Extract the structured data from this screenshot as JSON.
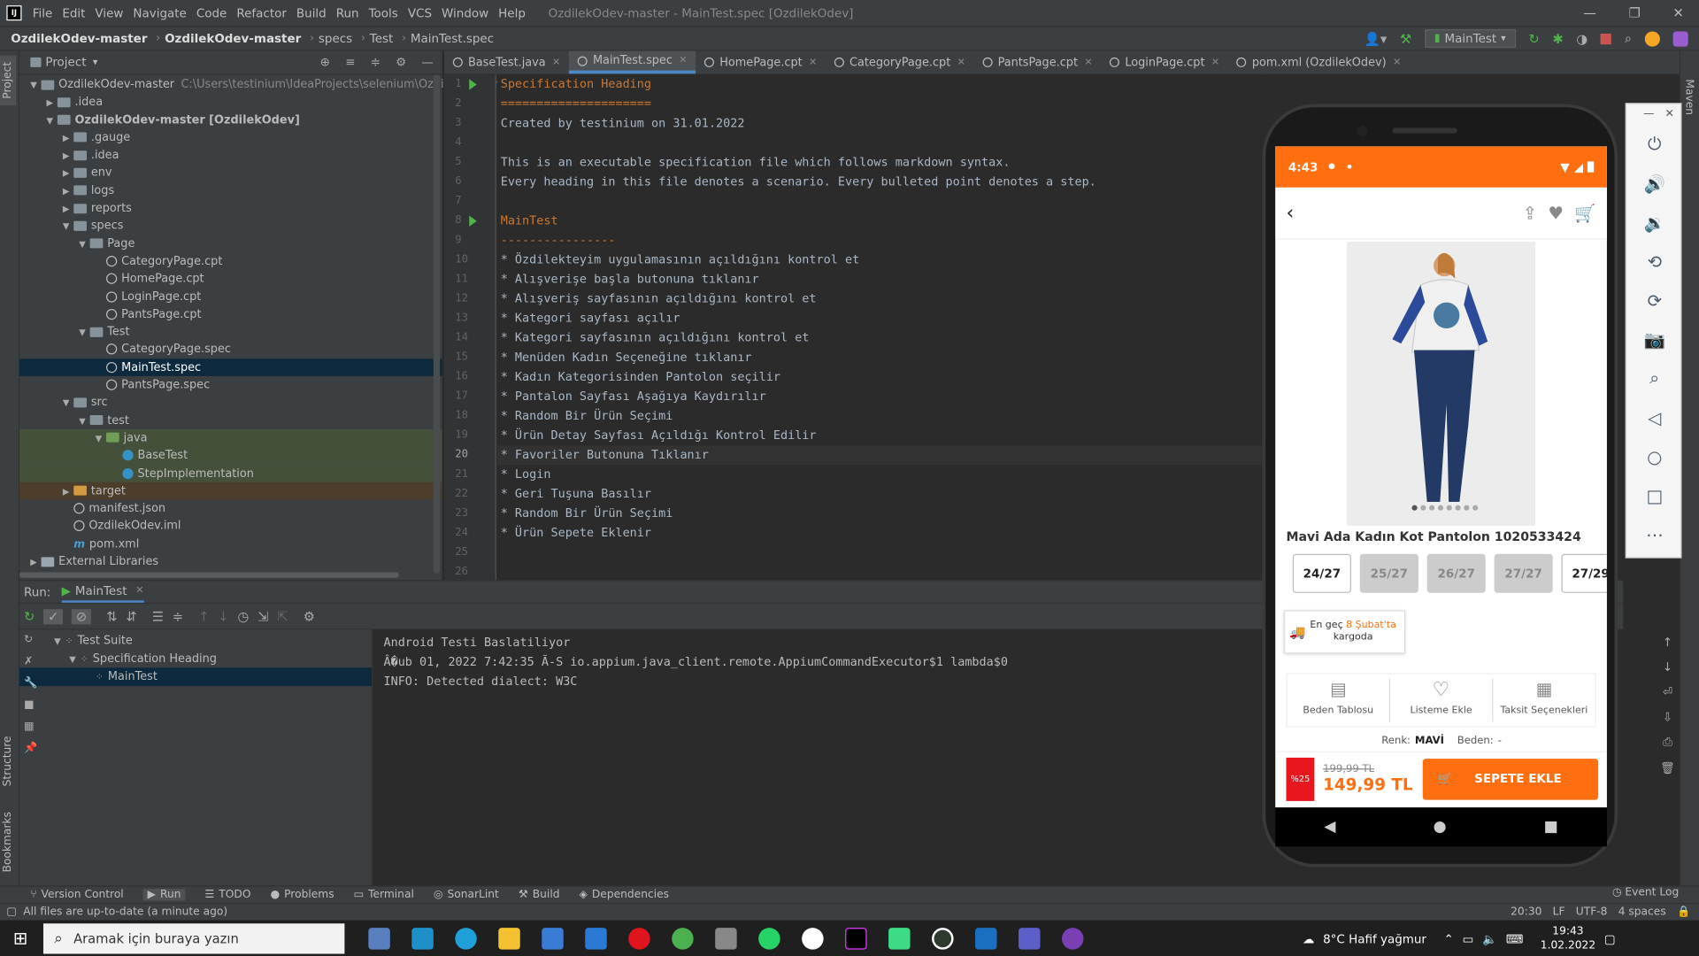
{
  "menu": [
    "File",
    "Edit",
    "View",
    "Navigate",
    "Code",
    "Refactor",
    "Build",
    "Run",
    "Tools",
    "VCS",
    "Window",
    "Help"
  ],
  "window_title": "OzdilekOdev-master - MainTest.spec [OzdilekOdev]",
  "breadcrumb": [
    "OzdilekOdev-master",
    "OzdilekOdev-master",
    "specs",
    "Test",
    "MainTest.spec"
  ],
  "run_config": "MainTest",
  "project": {
    "header": "Project",
    "tree": [
      {
        "label": "OzdilekOdev-master",
        "hint": "C:\\Users\\testinium\\IdeaProjects\\selenium\\OzdilekOdev-ma",
        "depth": 0,
        "arrow": "▼",
        "icon": "folder"
      },
      {
        "label": ".idea",
        "depth": 1,
        "arrow": "▶",
        "icon": "folder"
      },
      {
        "label": "OzdilekOdev-master [OzdilekOdev]",
        "depth": 1,
        "arrow": "▼",
        "icon": "folder",
        "bold": true
      },
      {
        "label": ".gauge",
        "depth": 2,
        "arrow": "▶",
        "icon": "folder"
      },
      {
        "label": ".idea",
        "depth": 2,
        "arrow": "▶",
        "icon": "folder"
      },
      {
        "label": "env",
        "depth": 2,
        "arrow": "▶",
        "icon": "folder"
      },
      {
        "label": "logs",
        "depth": 2,
        "arrow": "▶",
        "icon": "folder"
      },
      {
        "label": "reports",
        "depth": 2,
        "arrow": "▶",
        "icon": "folder"
      },
      {
        "label": "specs",
        "depth": 2,
        "arrow": "▼",
        "icon": "folder"
      },
      {
        "label": "Page",
        "depth": 3,
        "arrow": "▼",
        "icon": "folder"
      },
      {
        "label": "CategoryPage.cpt",
        "depth": 4,
        "arrow": "",
        "icon": "file"
      },
      {
        "label": "HomePage.cpt",
        "depth": 4,
        "arrow": "",
        "icon": "file"
      },
      {
        "label": "LoginPage.cpt",
        "depth": 4,
        "arrow": "",
        "icon": "file"
      },
      {
        "label": "PantsPage.cpt",
        "depth": 4,
        "arrow": "",
        "icon": "file"
      },
      {
        "label": "Test",
        "depth": 3,
        "arrow": "▼",
        "icon": "folder"
      },
      {
        "label": "CategoryPage.spec",
        "depth": 4,
        "arrow": "",
        "icon": "file"
      },
      {
        "label": "MainTest.spec",
        "depth": 4,
        "arrow": "",
        "icon": "file",
        "selected": true
      },
      {
        "label": "PantsPage.spec",
        "depth": 4,
        "arrow": "",
        "icon": "file"
      },
      {
        "label": "src",
        "depth": 2,
        "arrow": "▼",
        "icon": "folder"
      },
      {
        "label": "test",
        "depth": 3,
        "arrow": "▼",
        "icon": "folder"
      },
      {
        "label": "java",
        "depth": 4,
        "arrow": "▼",
        "icon": "green",
        "green": true
      },
      {
        "label": "BaseTest",
        "depth": 5,
        "arrow": "",
        "icon": "class",
        "green": true
      },
      {
        "label": "StepImplementation",
        "depth": 5,
        "arrow": "",
        "icon": "class",
        "green": true
      },
      {
        "label": "target",
        "depth": 2,
        "arrow": "▶",
        "icon": "orange",
        "brown": true
      },
      {
        "label": "manifest.json",
        "depth": 2,
        "arrow": "",
        "icon": "file"
      },
      {
        "label": "OzdilekOdev.iml",
        "depth": 2,
        "arrow": "",
        "icon": "file"
      },
      {
        "label": "pom.xml",
        "depth": 2,
        "arrow": "",
        "icon": "maven"
      },
      {
        "label": "External Libraries",
        "depth": 0,
        "arrow": "▶",
        "icon": "lib"
      }
    ]
  },
  "tabs": [
    {
      "label": "BaseTest.java"
    },
    {
      "label": "MainTest.spec",
      "active": true
    },
    {
      "label": "HomePage.cpt"
    },
    {
      "label": "CategoryPage.cpt"
    },
    {
      "label": "PantsPage.cpt"
    },
    {
      "label": "LoginPage.cpt"
    },
    {
      "label": "pom.xml (OzdilekOdev)"
    }
  ],
  "code_lines": [
    "Specification Heading",
    "=====================",
    "Created by testinium on 31.01.2022",
    "",
    "This is an executable specification file which follows markdown syntax.",
    "Every heading in this file denotes a scenario. Every bulleted point denotes a step.",
    "",
    "MainTest",
    "----------------",
    "* Özdilekteyim uygulamasının açıldığını kontrol et",
    "* Alışverişe başla butonuna tıklanır",
    "* Alışveriş sayfasının açıldığını kontrol et",
    "* Kategori sayfası açılır",
    "* Kategori sayfasının açıldığını kontrol et",
    "* Menüden Kadın Seçeneğine tıklanır",
    "* Kadın Kategorisinden Pantolon seçilir",
    "* Pantalon Sayfası Aşağıya Kaydırılır",
    "* Random Bir Ürün Seçimi",
    "* Ürün Detay Sayfası Açıldığı Kontrol Edilir",
    "* Favoriler Butonuna Tıklanır",
    "* Login",
    "* Geri Tuşuna Basılır",
    "* Random Bir Ürün Seçimi",
    "* Ürün Sepete Eklenir",
    "",
    ""
  ],
  "run": {
    "label": "Run:",
    "config": "MainTest",
    "tree": [
      {
        "label": "Test Suite",
        "depth": 0
      },
      {
        "label": "Specification Heading",
        "depth": 1
      },
      {
        "label": "MainTest",
        "depth": 2,
        "selected": true
      }
    ],
    "console": [
      "Android Testi Baslatiliyor",
      "Â�ub 01, 2022 7:42:35 Ã-S io.appium.java_client.remote.AppiumCommandExecutor$1 lambda$0",
      "INFO: Detected dialect: W3C"
    ]
  },
  "bottom_tools": [
    "Version Control",
    "Run",
    "TODO",
    "Problems",
    "Terminal",
    "SonarLint",
    "Build",
    "Dependencies"
  ],
  "event_log": "Event Log",
  "status": {
    "message": "All files are up-to-date (a minute ago)",
    "position": "20:30",
    "line_sep": "LF",
    "encoding": "UTF-8",
    "indent": "4 spaces"
  },
  "left_vertical": [
    "Project",
    "Structure",
    "Bookmarks"
  ],
  "right_vertical": "Maven",
  "phone": {
    "time": "4:43",
    "product_title": "Mavi Ada Kadın Kot Pantolon 1020533424",
    "sizes": [
      {
        "label": "24/27",
        "available": true
      },
      {
        "label": "25/27",
        "available": false
      },
      {
        "label": "26/27",
        "available": false
      },
      {
        "label": "27/27",
        "available": false
      },
      {
        "label": "27/29",
        "available": true
      }
    ],
    "shipping_prefix": "En geç",
    "shipping_date": "8 Şubat'ta",
    "shipping_suffix": "kargoda",
    "actions": [
      "Beden Tablosu",
      "Listeme Ekle",
      "Taksit Seçenekleri"
    ],
    "color_label": "Renk:",
    "color_value": "MAVİ",
    "size_label": "Beden:",
    "size_value": "-",
    "discount": "%25",
    "old_price": "199,99 TL",
    "new_price": "149,99 TL",
    "cart_button": "SEPETE EKLE"
  },
  "taskbar": {
    "search": "Aramak için buraya yazın",
    "weather": "8°C  Hafif yağmur",
    "time": "19:43",
    "date": "1.02.2022"
  },
  "colors": {
    "accent": "#ff6f0f",
    "ide_bg": "#2b2b2b",
    "panel": "#3c3f41",
    "selection": "#0d293e",
    "heading": "#cc7832",
    "run_green": "#4fb34a"
  }
}
